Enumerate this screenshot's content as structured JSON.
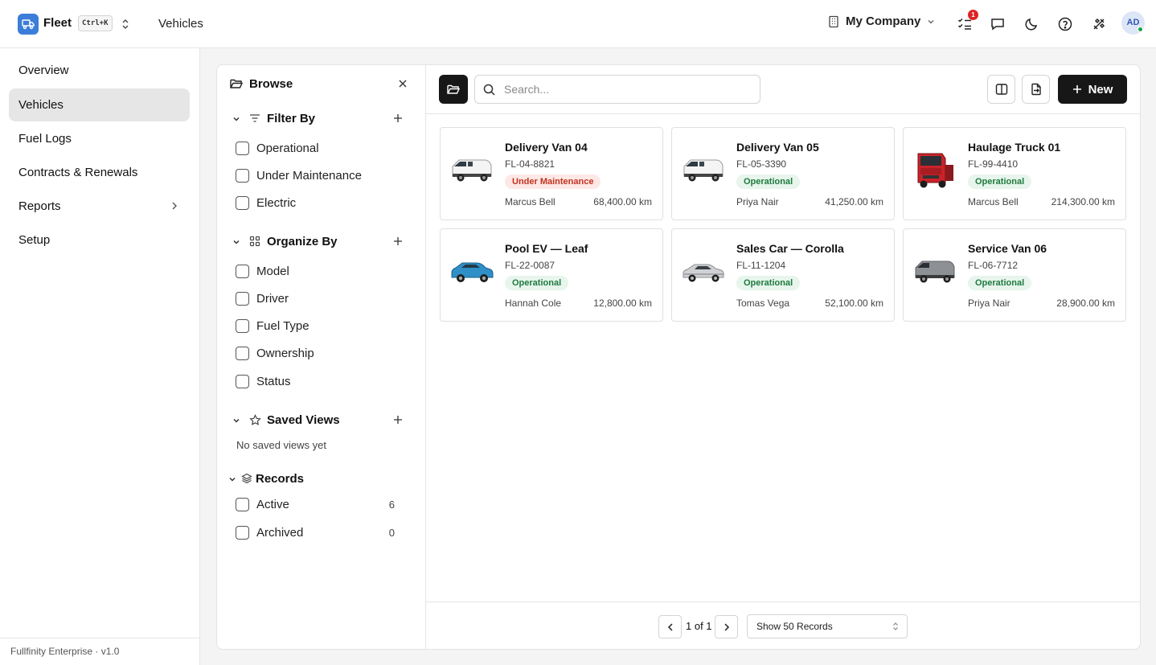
{
  "header": {
    "app_name": "Fleet",
    "shortcut": "Ctrl+K",
    "breadcrumb": "Vehicles",
    "company": "My Company",
    "notification_count": "1",
    "avatar_initials": "AD"
  },
  "sidebar": {
    "items": [
      {
        "label": "Overview"
      },
      {
        "label": "Vehicles",
        "active": true
      },
      {
        "label": "Fuel Logs"
      },
      {
        "label": "Contracts & Renewals"
      },
      {
        "label": "Reports",
        "has_submenu": true
      },
      {
        "label": "Setup"
      }
    ],
    "footer": "Fullfinity Enterprise · v1.0"
  },
  "browse": {
    "title": "Browse",
    "filter_by": {
      "title": "Filter By",
      "options": [
        "Operational",
        "Under Maintenance",
        "Electric"
      ]
    },
    "organize_by": {
      "title": "Organize By",
      "options": [
        "Model",
        "Driver",
        "Fuel Type",
        "Ownership",
        "Status"
      ]
    },
    "saved_views": {
      "title": "Saved Views",
      "empty": "No saved views yet"
    },
    "records": {
      "title": "Records",
      "options": [
        {
          "label": "Active",
          "count": "6"
        },
        {
          "label": "Archived",
          "count": "0"
        }
      ]
    }
  },
  "toolbar": {
    "search_placeholder": "Search...",
    "new_label": "New"
  },
  "vehicles": [
    {
      "name": "Delivery Van 04",
      "plate": "FL-04-8821",
      "status": "Under Maintenance",
      "driver": "Marcus Bell",
      "odometer": "68,400.00 km",
      "image": "white-van"
    },
    {
      "name": "Delivery Van 05",
      "plate": "FL-05-3390",
      "status": "Operational",
      "driver": "Priya Nair",
      "odometer": "41,250.00 km",
      "image": "white-van"
    },
    {
      "name": "Haulage Truck 01",
      "plate": "FL-99-4410",
      "status": "Operational",
      "driver": "Marcus Bell",
      "odometer": "214,300.00 km",
      "image": "red-truck"
    },
    {
      "name": "Pool EV — Leaf",
      "plate": "FL-22-0087",
      "status": "Operational",
      "driver": "Hannah Cole",
      "odometer": "12,800.00 km",
      "image": "blue-hatchback"
    },
    {
      "name": "Sales Car — Corolla",
      "plate": "FL-11-1204",
      "status": "Operational",
      "driver": "Tomas Vega",
      "odometer": "52,100.00 km",
      "image": "silver-sedan"
    },
    {
      "name": "Service Van 06",
      "plate": "FL-06-7712",
      "status": "Operational",
      "driver": "Priya Nair",
      "odometer": "28,900.00 km",
      "image": "grey-van"
    }
  ],
  "pagination": {
    "page_text": "1 of 1",
    "page_size": "Show 50 Records"
  },
  "colors": {
    "brand": "#3b7dd8",
    "primary_button": "#171717",
    "operational_bg": "#e7f5ec",
    "operational_text": "#1f7a3f",
    "maintenance_bg": "#fde8e6",
    "maintenance_text": "#c2331f"
  }
}
